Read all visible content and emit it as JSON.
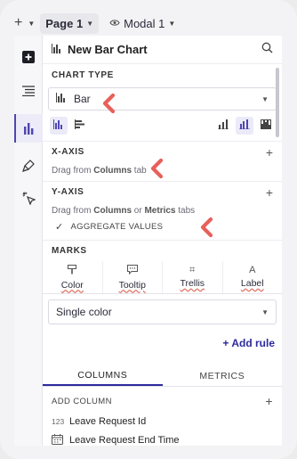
{
  "tabs": [
    {
      "label": "Page 1",
      "active": true
    },
    {
      "label": "Modal 1",
      "active": false
    }
  ],
  "panel": {
    "title": "New Bar Chart"
  },
  "chart_type": {
    "label": "CHART TYPE",
    "selected": "Bar"
  },
  "x_axis": {
    "label": "X-AXIS",
    "hint_prefix": "Drag from ",
    "hint_bold": "Columns",
    "hint_suffix": " tab"
  },
  "y_axis": {
    "label": "Y-AXIS",
    "hint_prefix": "Drag from ",
    "hint_bold1": "Columns",
    "hint_mid": " or ",
    "hint_bold2": "Metrics",
    "hint_suffix": " tabs",
    "aggregate_label": "AGGREGATE VALUES",
    "aggregate_checked": true
  },
  "marks": {
    "label": "MARKS",
    "tabs": [
      "Color",
      "Tooltip",
      "Trellis",
      "Label"
    ],
    "color_select": "Single color",
    "add_rule": "+ Add rule"
  },
  "data_tabs": [
    "COLUMNS",
    "METRICS"
  ],
  "add_column": "ADD COLUMN",
  "fields": [
    {
      "type": "123",
      "name": "Leave Request Id"
    },
    {
      "type": "date",
      "name": "Leave Request End Time"
    }
  ],
  "colors": {
    "accent": "#2d2a9e",
    "annotation": "#e8605a"
  },
  "icons": {
    "rail": [
      "plus-square-icon",
      "list-indent-icon",
      "bar-chart-icon",
      "brush-icon",
      "pointer-click-icon"
    ],
    "header": [
      "bar-chart-icon",
      "search-icon"
    ]
  }
}
